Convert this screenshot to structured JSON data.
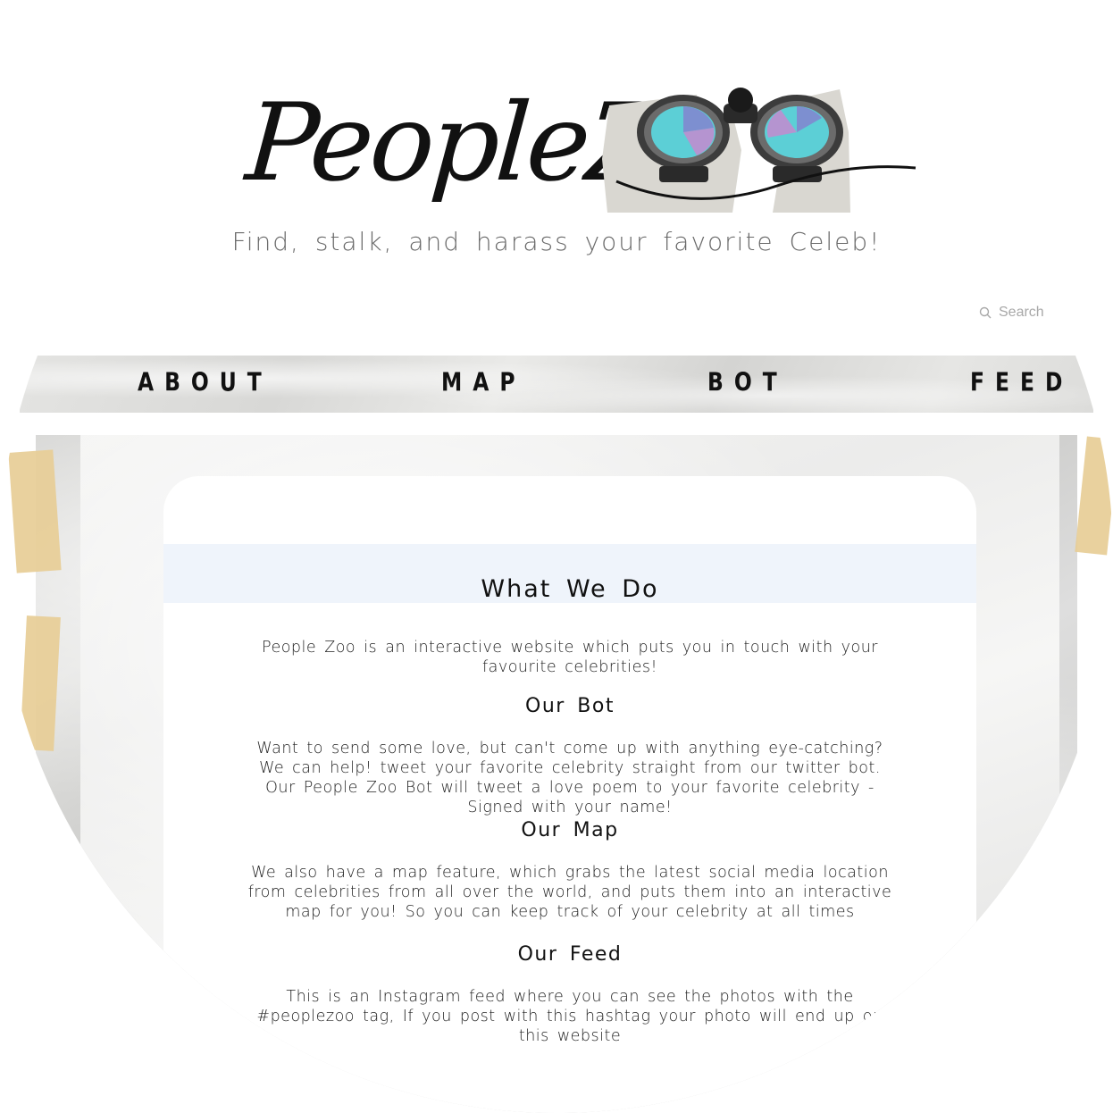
{
  "header": {
    "logo_text": "PeopleZ",
    "tagline": "Find, stalk, and harass your favorite Celeb!"
  },
  "search": {
    "placeholder": "Search",
    "icon": "search-icon"
  },
  "nav": {
    "items": [
      {
        "label": "ABOUT"
      },
      {
        "label": "MAP"
      },
      {
        "label": "BOT"
      },
      {
        "label": "FEED"
      }
    ]
  },
  "main": {
    "title": "What We Do",
    "intro": "People Zoo is an interactive website which puts you in touch with your favourite celebrities!",
    "sections": [
      {
        "heading": "Our Bot",
        "body": "Want to send some love, but can't come up with anything eye-catching? We can help! tweet your favorite celebrity straight from our twitter bot. Our People Zoo Bot will tweet a love poem to your favorite celebrity - Signed with your name!"
      },
      {
        "heading": "Our Map",
        "body": "We also have a map feature, which grabs the latest social media location from celebrities from all over the world, and puts them into an interactive map for you! So you can keep track of your celebrity at all times"
      },
      {
        "heading": "Our Feed",
        "body": "This is an Instagram feed where you can see the photos with the #peoplezoo tag, If you post with this hashtag your photo will end up on this website"
      }
    ]
  },
  "colors": {
    "band": "#eff4fb",
    "lens": "#5ccfd6",
    "lens_purple": "#b594d0",
    "lens_blue": "#7d8fd0",
    "tape": "#e7cd96"
  }
}
